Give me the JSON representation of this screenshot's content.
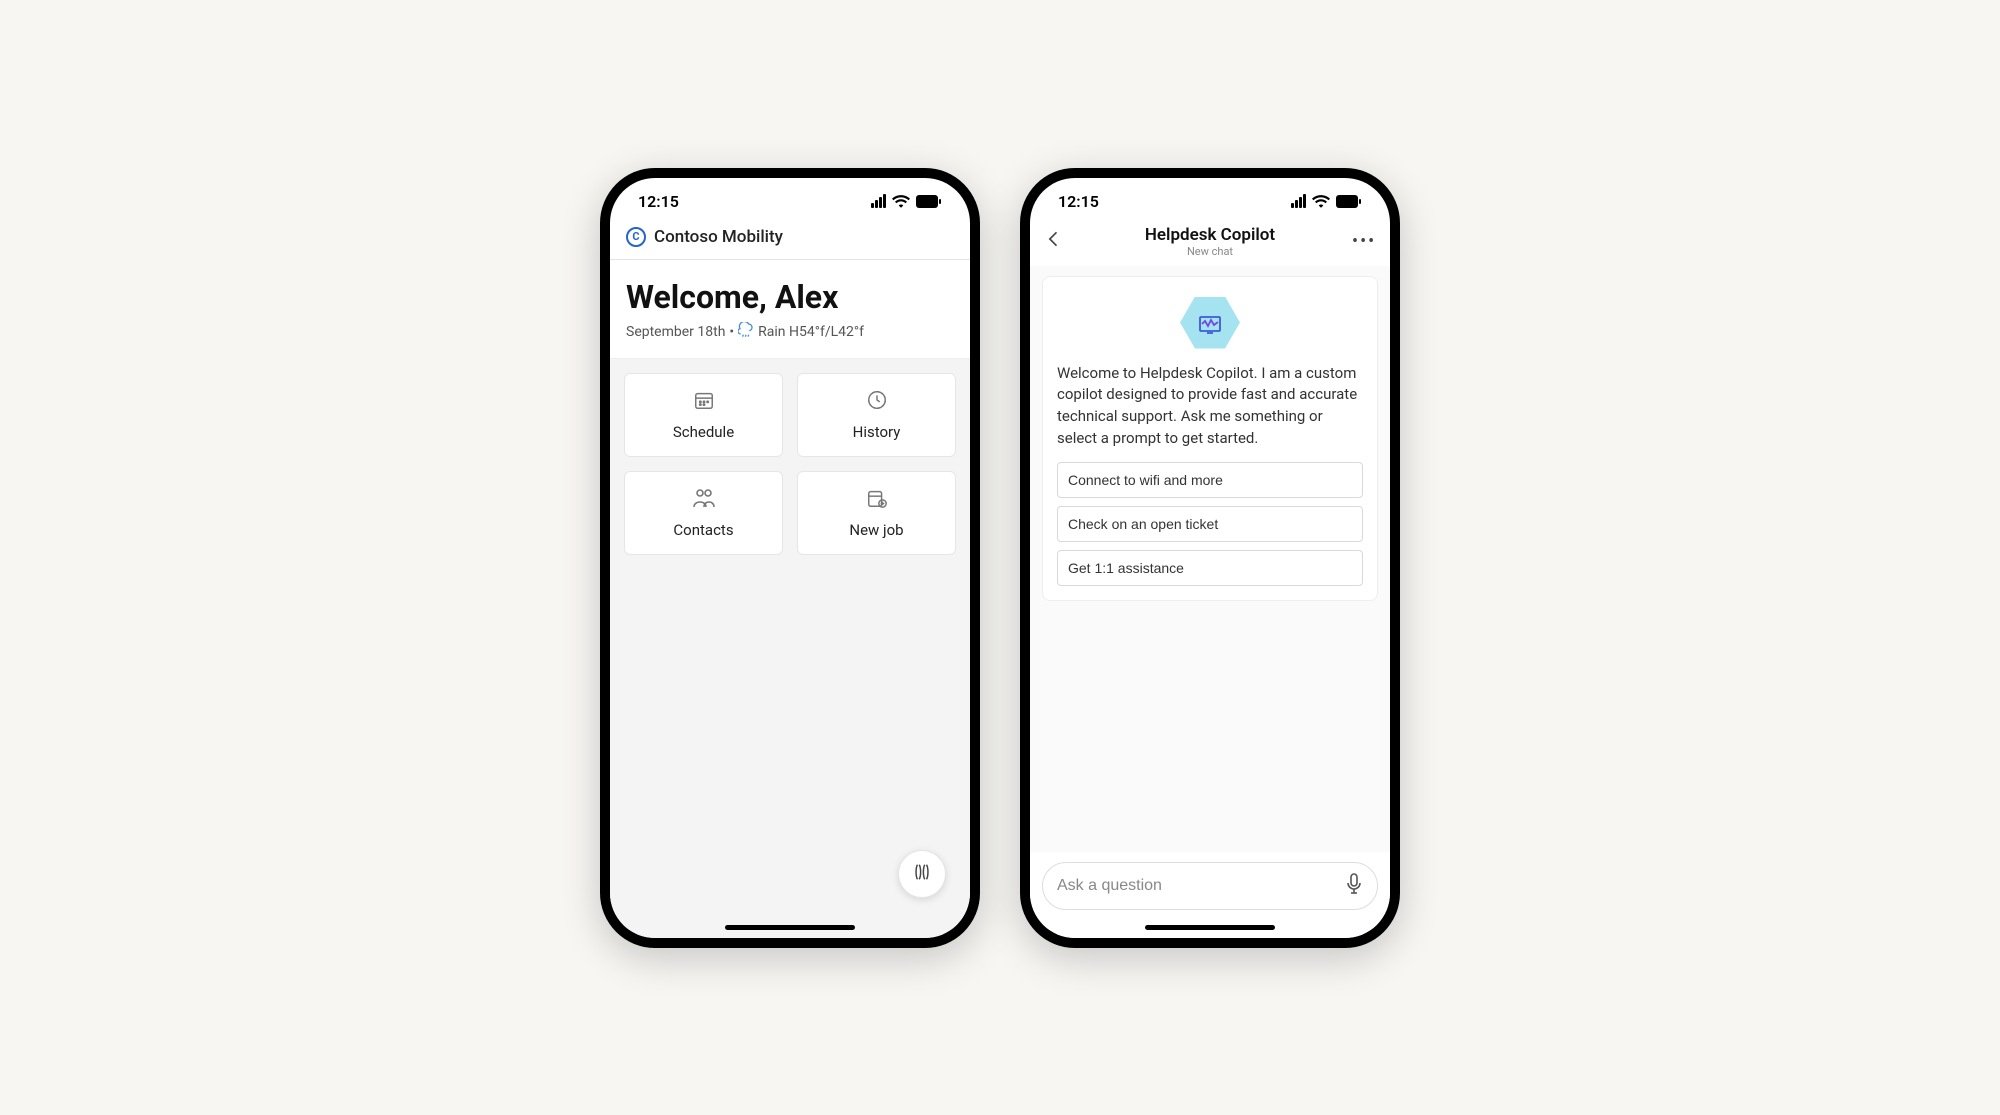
{
  "status": {
    "time": "12:15"
  },
  "phone1": {
    "app_name": "Contoso Mobility",
    "welcome": "Welcome, Alex",
    "date": "September 18th",
    "weather": "Rain H54°f/L42°f",
    "tiles": [
      {
        "label": "Schedule"
      },
      {
        "label": "History"
      },
      {
        "label": "Contacts"
      },
      {
        "label": "New job"
      }
    ]
  },
  "phone2": {
    "title": "Helpdesk Copilot",
    "subtitle": "New chat",
    "welcome_text": "Welcome to Helpdesk Copilot. I am a custom copilot designed to provide fast and accurate technical support. Ask me something or select a prompt to get started.",
    "prompts": [
      "Connect to wifi and more",
      "Check on an open ticket",
      "Get 1:1 assistance"
    ],
    "input_placeholder": "Ask a question"
  }
}
